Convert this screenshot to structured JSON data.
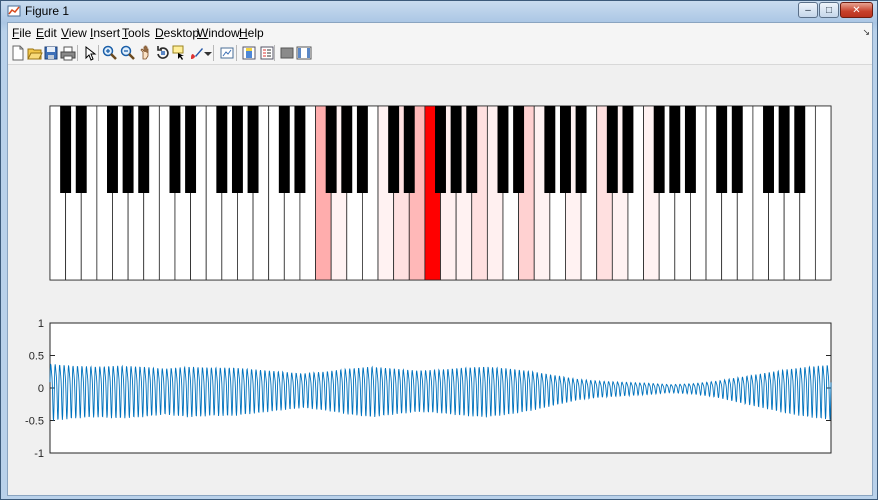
{
  "window": {
    "title": "Figure 1",
    "controls": [
      "minimize-icon",
      "maximize-icon",
      "close-icon"
    ]
  },
  "menubar": {
    "items": [
      {
        "label": "File",
        "accel": "F"
      },
      {
        "label": "Edit",
        "accel": "E"
      },
      {
        "label": "View",
        "accel": "V"
      },
      {
        "label": "Insert",
        "accel": "I"
      },
      {
        "label": "Tools",
        "accel": "T"
      },
      {
        "label": "Desktop",
        "accel": "D"
      },
      {
        "label": "Window",
        "accel": "W"
      },
      {
        "label": "Help",
        "accel": "H"
      }
    ]
  },
  "toolbar": {
    "icons": [
      "new-figure-icon",
      "open-file-icon",
      "save-icon",
      "print-icon",
      "edit-plot-icon",
      "zoom-in-icon",
      "zoom-out-icon",
      "pan-icon",
      "rotate-3d-icon",
      "data-cursor-icon",
      "brush-icon",
      "brush-menu-icon",
      "link-plot-icon",
      "insert-colorbar-icon",
      "insert-legend-icon",
      "hide-plot-tools-icon",
      "show-plot-tools-icon"
    ]
  },
  "piano": {
    "white_key_color": "#ffffff",
    "black_key_color": "#000000",
    "highlight_color": "#ff0000",
    "white_key_count": 50,
    "highlights": [
      {
        "white_index": 17,
        "intensity": 0.32
      },
      {
        "white_index": 18,
        "intensity": 0.05
      },
      {
        "white_index": 21,
        "intensity": 0.05
      },
      {
        "white_index": 22,
        "intensity": 0.12
      },
      {
        "white_index": 23,
        "intensity": 0.28
      },
      {
        "white_index": 24,
        "intensity": 1.0
      },
      {
        "white_index": 25,
        "intensity": 0.06
      },
      {
        "white_index": 26,
        "intensity": 0.05
      },
      {
        "white_index": 27,
        "intensity": 0.12
      },
      {
        "white_index": 28,
        "intensity": 0.06
      },
      {
        "white_index": 30,
        "intensity": 0.18
      },
      {
        "white_index": 31,
        "intensity": 0.05
      },
      {
        "white_index": 33,
        "intensity": 0.05
      },
      {
        "white_index": 35,
        "intensity": 0.12
      },
      {
        "white_index": 36,
        "intensity": 0.05
      },
      {
        "white_index": 38,
        "intensity": 0.05
      }
    ]
  },
  "chart_data": {
    "type": "line",
    "title": "",
    "xlabel": "",
    "ylabel": "",
    "ylim": [
      -1,
      1
    ],
    "yticks": [
      "1",
      "0.5",
      "0",
      "-0.5",
      "-1"
    ],
    "ytick_values": [
      1,
      0.5,
      0,
      -0.5,
      -1
    ],
    "series": [
      {
        "color": "#0072bd",
        "cycles": 175,
        "envelope": [
          0.5,
          0.46,
          0.44,
          0.46,
          0.44,
          0.4,
          0.44,
          0.42,
          0.42,
          0.38,
          0.34,
          0.3,
          0.34,
          0.4,
          0.44,
          0.4,
          0.36,
          0.38,
          0.42,
          0.44,
          0.4,
          0.34,
          0.26,
          0.18,
          0.14,
          0.12,
          0.1,
          0.07,
          0.09,
          0.14,
          0.22,
          0.3,
          0.38,
          0.44,
          0.48
        ]
      }
    ]
  }
}
